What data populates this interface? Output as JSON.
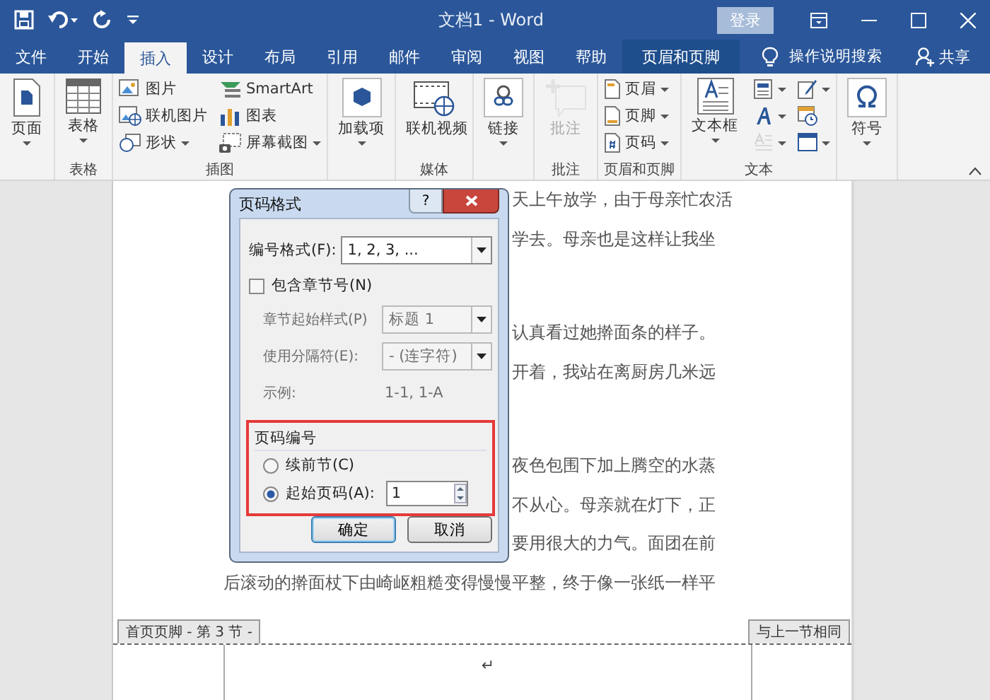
{
  "window": {
    "title": "文档1 - Word",
    "sign_in": "登录"
  },
  "tabs": [
    {
      "label": "文件",
      "selected": false,
      "kind": "normal"
    },
    {
      "label": "开始",
      "selected": false,
      "kind": "normal"
    },
    {
      "label": "插入",
      "selected": true,
      "kind": "normal"
    },
    {
      "label": "设计",
      "selected": false,
      "kind": "normal"
    },
    {
      "label": "布局",
      "selected": false,
      "kind": "normal"
    },
    {
      "label": "引用",
      "selected": false,
      "kind": "normal"
    },
    {
      "label": "邮件",
      "selected": false,
      "kind": "normal"
    },
    {
      "label": "审阅",
      "selected": false,
      "kind": "normal"
    },
    {
      "label": "视图",
      "selected": false,
      "kind": "normal"
    },
    {
      "label": "帮助",
      "selected": false,
      "kind": "normal"
    },
    {
      "label": "页眉和页脚",
      "selected": false,
      "kind": "contextual"
    }
  ],
  "tell_me": "操作说明搜索",
  "share": "共享",
  "ribbon": {
    "groups": [
      {
        "items": [
          {
            "kind": "large",
            "label": "页面",
            "dropdown": true,
            "disabled": false
          }
        ]
      },
      {
        "label": "表格",
        "items": [
          {
            "kind": "large",
            "label": "表格",
            "dropdown": true,
            "disabled": false
          }
        ]
      },
      {
        "label": "插图",
        "items": [
          {
            "kind": "column",
            "children": [
              {
                "label": "图片",
                "dropdown": false,
                "disabled": false
              },
              {
                "label": "联机图片",
                "dropdown": false,
                "disabled": false
              },
              {
                "label": "形状",
                "dropdown": true,
                "disabled": false
              }
            ]
          },
          {
            "kind": "column",
            "children": [
              {
                "label": "SmartArt",
                "dropdown": false,
                "disabled": false
              },
              {
                "label": "图表",
                "dropdown": false,
                "disabled": false
              },
              {
                "label": "屏幕截图",
                "dropdown": true,
                "disabled": false
              }
            ]
          }
        ]
      },
      {
        "items": [
          {
            "kind": "large",
            "label": "加载项",
            "dropdown": true,
            "disabled": false
          }
        ]
      },
      {
        "label": "媒体",
        "items": [
          {
            "kind": "large",
            "label": "联机视频",
            "dropdown": false,
            "disabled": false
          }
        ]
      },
      {
        "items": [
          {
            "kind": "large",
            "label": "链接",
            "dropdown": true,
            "disabled": false
          }
        ]
      },
      {
        "label": "批注",
        "items": [
          {
            "kind": "large",
            "label": "批注",
            "dropdown": false,
            "disabled": true
          }
        ]
      },
      {
        "label": "页眉和页脚",
        "items": [
          {
            "kind": "column",
            "children": [
              {
                "label": "页眉",
                "dropdown": true,
                "disabled": false
              },
              {
                "label": "页脚",
                "dropdown": true,
                "disabled": false
              },
              {
                "label": "页码",
                "dropdown": true,
                "disabled": false
              }
            ]
          }
        ]
      },
      {
        "label": "文本",
        "items": [
          {
            "kind": "large",
            "label": "文本框",
            "dropdown": true,
            "disabled": false
          },
          {
            "kind": "column",
            "children": [
              {
                "dropdown": true,
                "disabled": false
              },
              {
                "dropdown": true,
                "disabled": false
              },
              {
                "dropdown": true,
                "disabled": true
              }
            ]
          },
          {
            "kind": "column",
            "children": [
              {
                "dropdown": true,
                "disabled": false
              },
              {
                "dropdown": false,
                "disabled": false
              },
              {
                "dropdown": true,
                "disabled": false
              }
            ]
          }
        ]
      },
      {
        "items": [
          {
            "kind": "large",
            "label": "符号",
            "dropdown": true,
            "disabled": false
          }
        ]
      }
    ]
  },
  "document": {
    "paragraphs": [
      {
        "lines": [
          {
            "text": "天上午放学，由于母亲忙农活",
            "kind": "partial"
          },
          {
            "text": "学去。母亲也是这样让我坐",
            "kind": "partial"
          }
        ]
      },
      {
        "lines": [
          {
            "text": "认真看过她擀面条的样子。",
            "kind": "partial"
          },
          {
            "text": "开着，我站在离厨房几米远",
            "kind": "partial"
          }
        ]
      },
      {
        "lines": [
          {
            "text": "夜色包围下加上腾空的水蒸",
            "kind": "partial"
          },
          {
            "text": "不从心。母亲就在灯下，正",
            "kind": "partial"
          },
          {
            "text": "要用很大的力气。面团在前",
            "kind": "partial"
          },
          {
            "text": "后滚动的擀面杖下由崎岖粗糙变得慢慢平整，终于像一张纸一样平",
            "kind": "full"
          }
        ]
      }
    ],
    "footer": {
      "label": "首页页脚 - 第 3 节 -",
      "same_as_previous": "与上一节相同",
      "mark": "↵"
    }
  },
  "dialog": {
    "title": "页码格式",
    "help_button": "?",
    "format": {
      "label": "编号格式(F):",
      "value": "1, 2, 3, ...",
      "disabled": false
    },
    "include_chapter": {
      "label": "包含章节号(N)",
      "checked": false
    },
    "chapter_fields": [
      {
        "label": "章节起始样式(P)",
        "value": "标题 1",
        "disabled": true
      },
      {
        "label": "使用分隔符(E):",
        "value": "-  (连字符)",
        "disabled": true
      }
    ],
    "example": {
      "label": "示例:",
      "value": "1-1, 1-A"
    },
    "numbering": {
      "title": "页码编号",
      "highlighted": true,
      "options": [
        {
          "label": "续前节(C)",
          "selected": false
        },
        {
          "label": "起始页码(A):",
          "selected": true,
          "value": "1"
        }
      ]
    },
    "buttons": [
      {
        "label": "确定",
        "default": true
      },
      {
        "label": "取消",
        "default": false
      }
    ]
  }
}
